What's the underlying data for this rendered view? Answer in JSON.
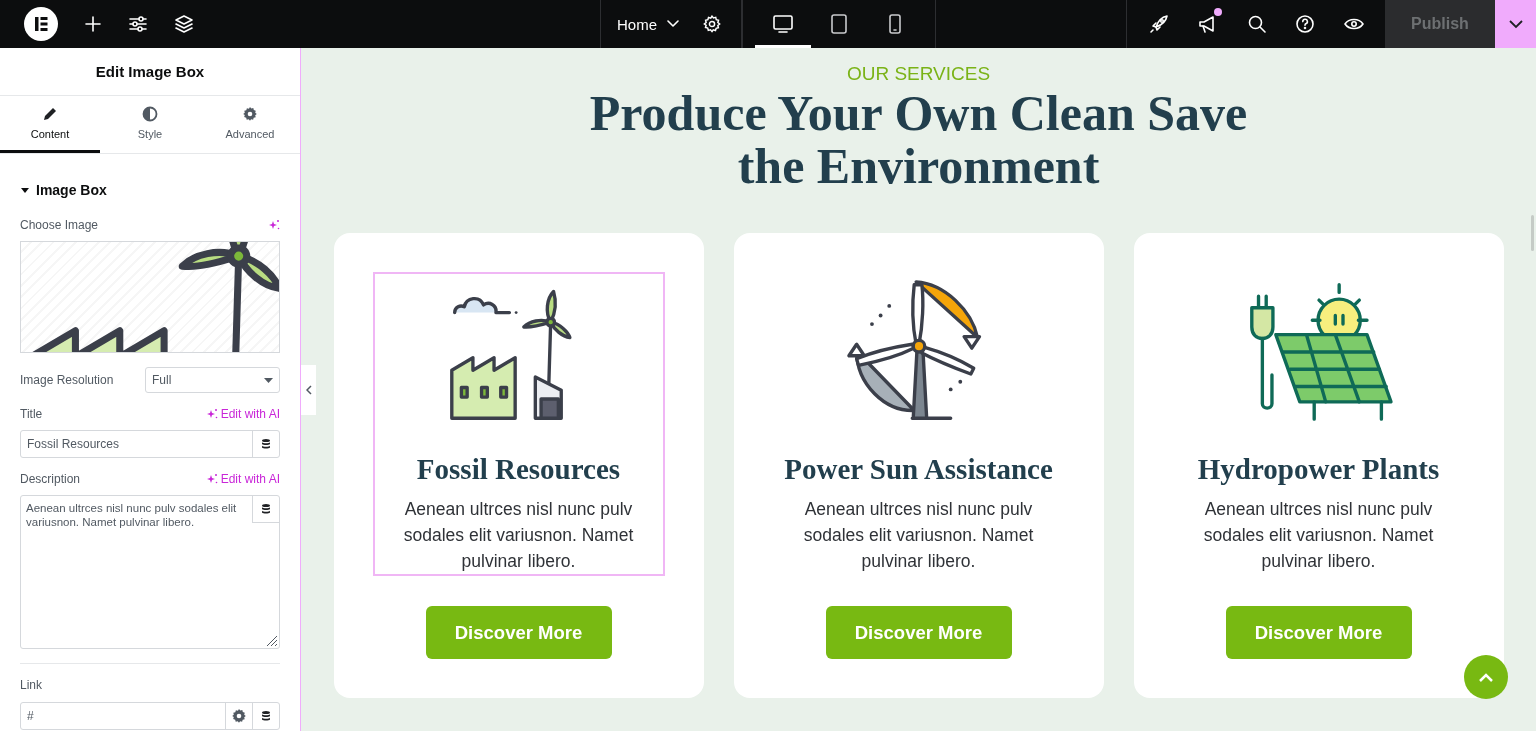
{
  "topbar": {
    "left_tools": [
      {
        "kind": "logo"
      },
      {
        "kind": "plus"
      },
      {
        "kind": "sliders"
      },
      {
        "kind": "layers"
      }
    ],
    "page_menu": "Home",
    "devices": [
      {
        "kind": "desktop",
        "selected": true
      },
      {
        "kind": "tablet",
        "selected": false
      },
      {
        "kind": "mobile",
        "selected": false
      }
    ],
    "right_tools": [
      {
        "kind": "rocket",
        "notification": false
      },
      {
        "kind": "megaphone",
        "notification": true
      },
      {
        "kind": "search",
        "notification": false
      },
      {
        "kind": "help",
        "notification": false
      },
      {
        "kind": "eye",
        "notification": false
      }
    ],
    "publish": "Publish"
  },
  "panel": {
    "title": "Edit Image Box",
    "tabs": [
      {
        "label": "Content",
        "kind": "pencil",
        "selected": true
      },
      {
        "label": "Style",
        "kind": "contrast",
        "selected": false
      },
      {
        "label": "Advanced",
        "kind": "gear",
        "selected": false
      }
    ],
    "section": {
      "title": "Image Box",
      "expanded": true
    },
    "choose_image": {
      "label": "Choose Image"
    },
    "resolution": {
      "label": "Image Resolution",
      "value": "Full"
    },
    "title_field": {
      "label": "Title",
      "ai": "Edit with AI",
      "value": "Fossil Resources"
    },
    "description_field": {
      "label": "Description",
      "ai": "Edit with AI",
      "value": "Aenean ultrces nisl nunc pulv sodales elit variusnon. Namet pulvinar libero."
    },
    "link_field": {
      "label": "Link",
      "value": "#"
    }
  },
  "canvas": {
    "eyebrow": "OUR SERVICES",
    "heading": "Produce Your Own Clean Save the Environment",
    "cards": [
      {
        "kind": "factory",
        "title": "Fossil Resources",
        "description": "Aenean ultrces nisl nunc pulv sodales elit variusnon. Namet pulvinar libero.",
        "button": "Discover More",
        "selected": true
      },
      {
        "kind": "turbine",
        "title": "Power Sun Assistance",
        "description": "Aenean ultrces nisl nunc pulv sodales elit variusnon. Namet pulvinar libero.",
        "button": "Discover More",
        "selected": false
      },
      {
        "kind": "solar",
        "title": "Hydropower Plants",
        "description": "Aenean ultrces nisl nunc pulv sodales elit variusnon. Namet pulvinar libero.",
        "button": "Discover More",
        "selected": false
      }
    ]
  }
}
